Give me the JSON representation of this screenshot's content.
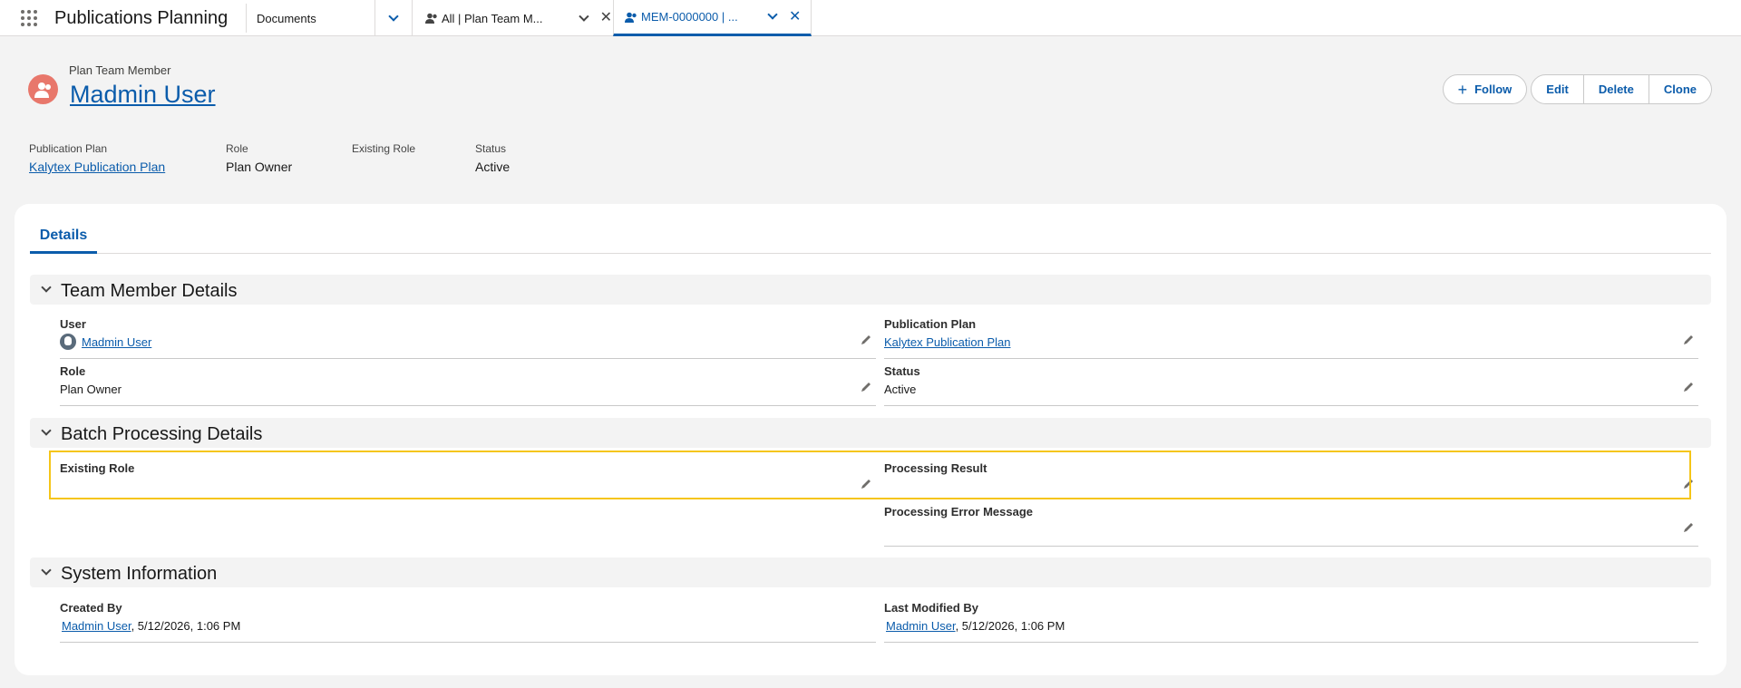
{
  "app": {
    "name": "Publications Planning"
  },
  "nav": {
    "tabs": [
      {
        "label": "Documents"
      },
      {
        "label": "All | Plan Team M..."
      },
      {
        "label": "MEM-0000000 | ..."
      }
    ]
  },
  "record": {
    "object_type": "Plan Team Member",
    "title": "Madmin User"
  },
  "actions": {
    "follow": "Follow",
    "edit": "Edit",
    "delete": "Delete",
    "clone": "Clone"
  },
  "highlights": [
    {
      "label": "Publication Plan",
      "value": "Kalytex Publication Plan"
    },
    {
      "label": "Role",
      "value": "Plan Owner"
    },
    {
      "label": "Existing Role",
      "value": ""
    },
    {
      "label": "Status",
      "value": "Active"
    }
  ],
  "tabs": {
    "details": "Details"
  },
  "sections": {
    "team_member": {
      "title": "Team Member Details",
      "user_label": "User",
      "user_value": "Madmin User",
      "plan_label": "Publication Plan",
      "plan_value": "Kalytex Publication Plan",
      "role_label": "Role",
      "role_value": "Plan Owner",
      "status_label": "Status",
      "status_value": "Active"
    },
    "batch": {
      "title": "Batch Processing Details",
      "existing_role_label": "Existing Role",
      "existing_role_value": "",
      "result_label": "Processing Result",
      "result_value": "",
      "error_label": "Processing Error Message",
      "error_value": ""
    },
    "system": {
      "title": "System Information",
      "created_label": "Created By",
      "created_user": "Madmin User",
      "created_date": ", 5/12/2026, 1:06 PM",
      "modified_label": "Last Modified By",
      "modified_user": "Madmin User",
      "modified_date": ", 5/12/2026, 1:06 PM"
    }
  },
  "colors": {
    "brand": "#0b5cab",
    "record_icon": "#e8776b",
    "highlight_box": "#f5c518"
  }
}
